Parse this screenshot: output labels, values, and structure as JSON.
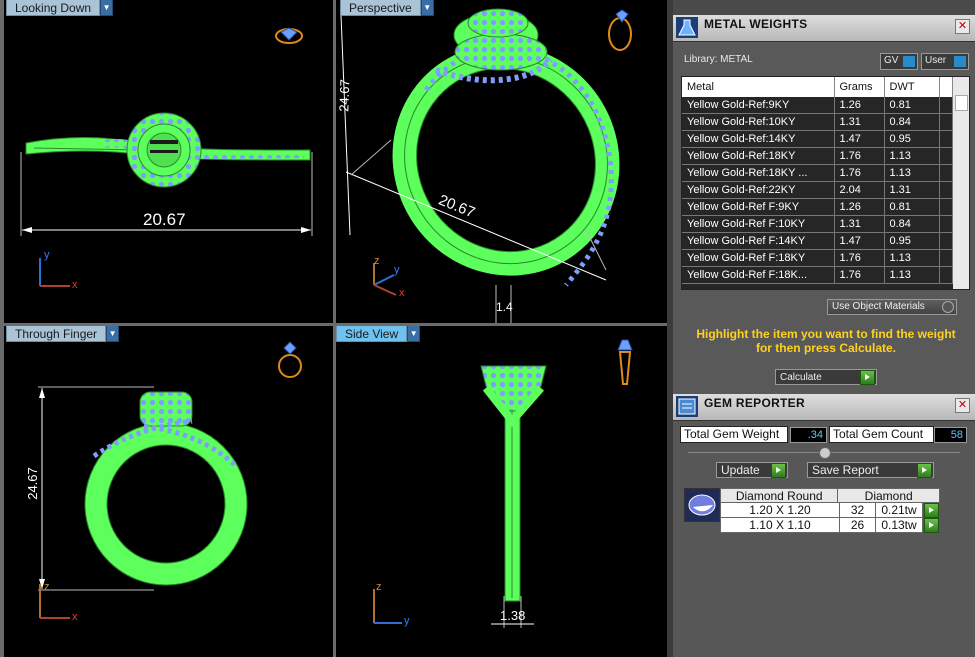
{
  "viewports": {
    "looking_down": {
      "label": "Looking Down",
      "dimension": "20.67"
    },
    "perspective": {
      "label": "Perspective",
      "dimension_a": "24.67",
      "dimension_b": "20.67",
      "dimension_c": "1.4"
    },
    "through_finger": {
      "label": "Through Finger",
      "dimension": "24.67"
    },
    "side_view": {
      "label": "Side View",
      "dimension": "1.38"
    }
  },
  "axes": {
    "x": "x",
    "y": "y",
    "z": "z"
  },
  "metal_weights": {
    "title": "METAL WEIGHTS",
    "library_label": "Library:",
    "library_value": "METAL",
    "gv_label": "GV",
    "user_label": "User",
    "columns": [
      "Metal",
      "Grams",
      "DWT"
    ],
    "rows": [
      [
        "Yellow Gold-Ref:9KY",
        "1.26",
        "0.81"
      ],
      [
        "Yellow Gold-Ref:10KY",
        "1.31",
        "0.84"
      ],
      [
        "Yellow Gold-Ref:14KY",
        "1.47",
        "0.95"
      ],
      [
        "Yellow Gold-Ref:18KY",
        "1.76",
        "1.13"
      ],
      [
        "Yellow Gold-Ref:18KY ...",
        "1.76",
        "1.13"
      ],
      [
        "Yellow Gold-Ref:22KY",
        "2.04",
        "1.31"
      ],
      [
        "Yellow Gold-Ref F:9KY",
        "1.26",
        "0.81"
      ],
      [
        "Yellow Gold-Ref F:10KY",
        "1.31",
        "0.84"
      ],
      [
        "Yellow Gold-Ref F:14KY",
        "1.47",
        "0.95"
      ],
      [
        "Yellow Gold-Ref F:18KY",
        "1.76",
        "1.13"
      ],
      [
        "Yellow Gold-Ref F:18K...",
        "1.76",
        "1.13"
      ]
    ],
    "use_object_materials": "Use Object Materials",
    "instruction": "Highlight the item you want to find the weight for then press Calculate.",
    "calculate": "Calculate"
  },
  "gem_reporter": {
    "title": "GEM REPORTER",
    "total_weight_label": "Total Gem Weight",
    "total_weight_value": ".34",
    "total_count_label": "Total Gem Count",
    "total_count_value": "58",
    "update": "Update",
    "save_report": "Save Report",
    "gem_header_shape": "Diamond Round",
    "gem_header_type": "Diamond",
    "gems": [
      {
        "size": "1.20 X 1.20",
        "count": "32",
        "weight": "0.21tw"
      },
      {
        "size": "1.10 X 1.10",
        "count": "26",
        "weight": "0.13tw"
      }
    ]
  },
  "colors": {
    "ring_green": "#5cff5c",
    "gem_blue": "#7f9cff",
    "accent_yellow": "#ffd21e"
  }
}
